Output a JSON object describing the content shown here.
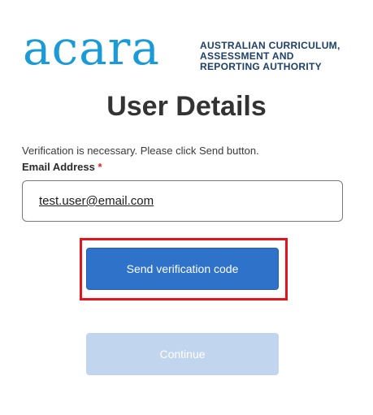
{
  "logo": {
    "wordmark": "acara",
    "text_lines": [
      "AUSTRALIAN CURRICULUM,",
      "ASSESSMENT AND",
      "REPORTING AUTHORITY"
    ]
  },
  "page": {
    "title": "User Details",
    "intro": "Verification is necessary. Please click Send button."
  },
  "form": {
    "email_label": "Email Address",
    "required_marker": "*",
    "email_value": "test.user@email.com",
    "send_button_label": "Send verification code",
    "continue_button_label": "Continue"
  },
  "colors": {
    "brand_blue": "#1a9bd7",
    "brand_navy": "#1d3f6b",
    "primary_button": "#2f72c9",
    "disabled_button": "#c2d5ee",
    "highlight": "#e3141c"
  }
}
